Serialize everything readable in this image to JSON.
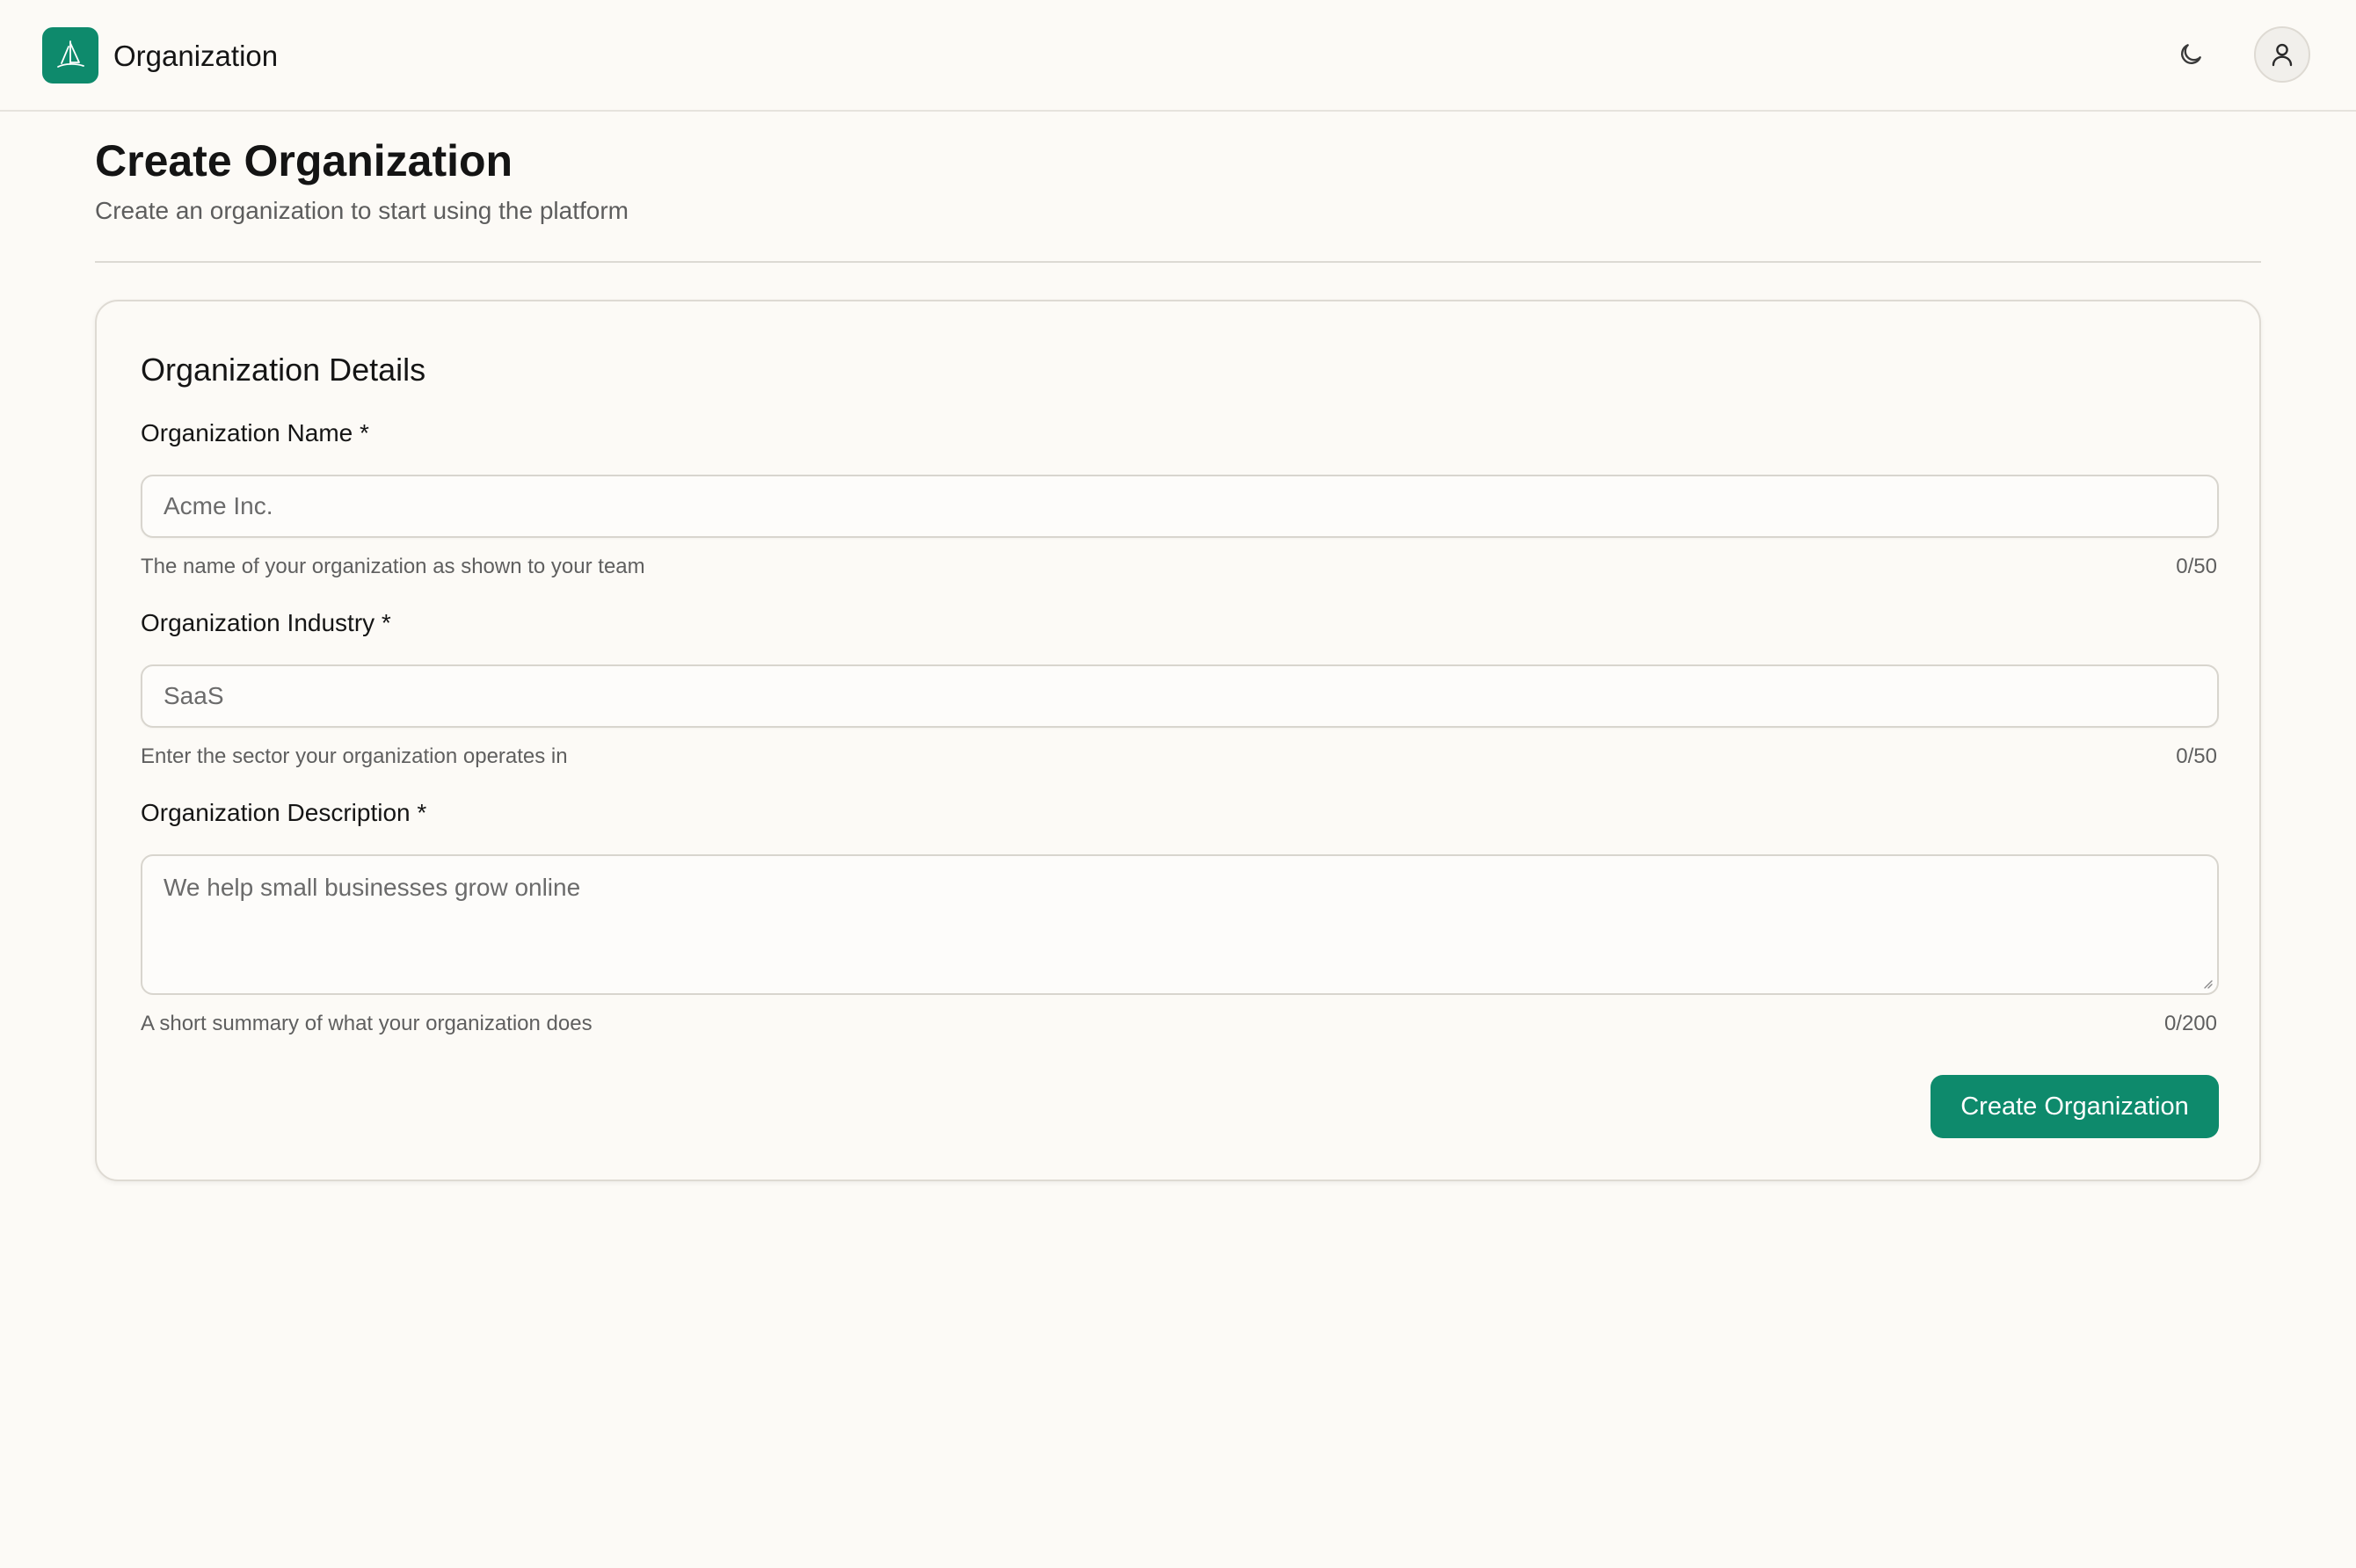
{
  "header": {
    "app_title": "Organization",
    "logo_icon": "sailboat-icon",
    "theme_icon": "moon-icon",
    "account_icon": "user-icon",
    "brand_color": "#0e8a6c"
  },
  "page": {
    "title": "Create Organization",
    "subtitle": "Create an organization to start using the platform"
  },
  "card": {
    "title": "Organization Details",
    "fields": [
      {
        "label": "Organization Name *",
        "placeholder": "Acme Inc.",
        "hint": "The name of your organization as shown to your team",
        "counter": "0/50"
      },
      {
        "label": "Organization Industry *",
        "placeholder": "SaaS",
        "hint": "Enter the sector your organization operates in",
        "counter": "0/50"
      },
      {
        "label": "Organization Description *",
        "placeholder": "We help small businesses grow online",
        "hint": "A short summary of what your organization does",
        "counter": "0/200"
      }
    ],
    "submit_label": "Create Organization"
  }
}
